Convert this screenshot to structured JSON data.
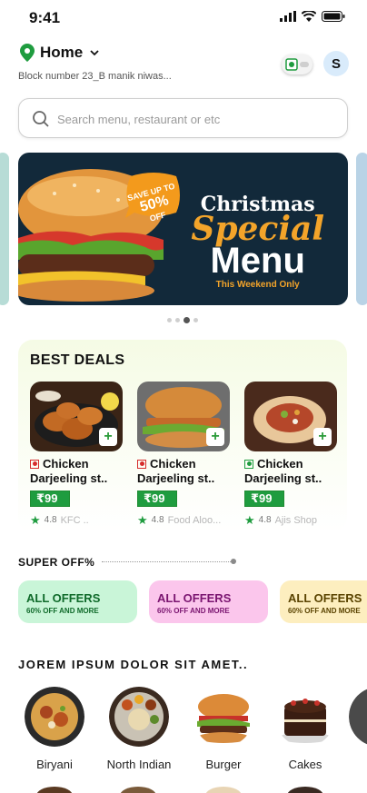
{
  "status": {
    "time": "9:41"
  },
  "header": {
    "location_title": "Home",
    "address": "Block number 23_B manik niwas...",
    "avatar_initial": "S"
  },
  "search": {
    "placeholder": "Search menu, restaurant or etc"
  },
  "banner": {
    "line1": "Christmas",
    "line2": "Special",
    "line3": "Menu",
    "line4": "This Weekend Only",
    "badge_top": "SAVE UP TO",
    "badge_value": "50%",
    "badge_bottom": "OFF",
    "active_slide": 3,
    "slide_count": 4
  },
  "best_deals": {
    "title": "BEST DEALS",
    "items": [
      {
        "name1": "Chicken",
        "name2": "Darjeeling st..",
        "price": "₹99",
        "rating": "4.8",
        "shop": "KFC ..",
        "diet": "non-veg"
      },
      {
        "name1": "Chicken",
        "name2": "Darjeeling st..",
        "price": "₹99",
        "rating": "4.8",
        "shop": "Food Aloo...",
        "diet": "non-veg"
      },
      {
        "name1": "Chicken",
        "name2": "Darjeeling st..",
        "price": "₹99",
        "rating": "4.8",
        "shop": "Ajis Shop",
        "diet": "veg"
      }
    ]
  },
  "super_off": {
    "label": "SUPER  OFF%",
    "offers": [
      {
        "title": "ALL OFFERS",
        "sub": "60% OFF AND MORE",
        "bg": "#c9f5d8",
        "color": "#0f6a2a"
      },
      {
        "title": "ALL OFFERS",
        "sub": "60% OFF AND MORE",
        "bg": "#fbc6ec",
        "color": "#7a1570"
      },
      {
        "title": "ALL OFFERS",
        "sub": "60% OFF AND MORE",
        "bg": "#fdeebf",
        "color": "#5a4300"
      }
    ]
  },
  "categories": {
    "title": "JOREM IPSUM DOLOR SIT AMET..",
    "items": [
      {
        "label": "Biryani"
      },
      {
        "label": "North Indian"
      },
      {
        "label": "Burger"
      },
      {
        "label": "Cakes"
      }
    ]
  },
  "colors": {
    "brand_green": "#1f9c3f",
    "banner_bg": "#12293a",
    "banner_accent": "#f3a42a"
  }
}
